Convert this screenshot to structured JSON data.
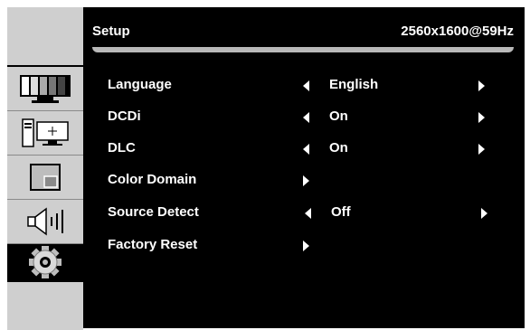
{
  "header": {
    "title": "Setup",
    "resolution": "2560x1600@59Hz"
  },
  "sidebar": {
    "items": [
      {
        "icon": "picture-bars-icon"
      },
      {
        "icon": "pc-monitor-icon"
      },
      {
        "icon": "pip-window-icon"
      },
      {
        "icon": "speaker-volume-icon"
      },
      {
        "icon": "gear-icon",
        "active": true
      }
    ]
  },
  "menu": {
    "rows": [
      {
        "label": "Language",
        "value": "English",
        "left_arrow": true,
        "right_arrow": true
      },
      {
        "label": "DCDi",
        "value": "On",
        "left_arrow": true,
        "right_arrow": true
      },
      {
        "label": "DLC",
        "value": "On",
        "left_arrow": true,
        "right_arrow": true
      },
      {
        "label": "Color Domain",
        "value": "",
        "left_arrow": false,
        "right_arrow": true
      },
      {
        "label": "Source Detect",
        "value": "Off",
        "left_arrow": true,
        "right_arrow": true
      },
      {
        "label": "Factory Reset",
        "value": "",
        "left_arrow": false,
        "right_arrow": true
      }
    ]
  },
  "colors": {
    "background": "#000000",
    "sidebar": "#cfcfcf",
    "text": "#ffffff",
    "header_bar": "#b9b9b9"
  }
}
